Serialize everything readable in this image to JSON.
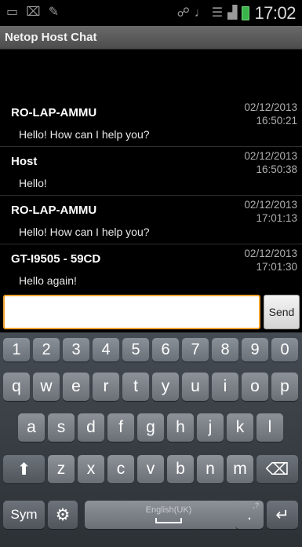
{
  "status_bar": {
    "time": "17:02",
    "icons_left": [
      "keyboard-icon",
      "usb-debug-icon",
      "wrench-icon"
    ],
    "icons_right": [
      "nfc-icon",
      "silent-mode-icon",
      "wifi-icon",
      "signal-icon",
      "battery-icon"
    ]
  },
  "app": {
    "title": "Netop Host Chat"
  },
  "messages": [
    {
      "sender": "RO-LAP-AMMU",
      "date": "02/12/2013",
      "time": "16:50:21",
      "text": "Hello! How can I help you?"
    },
    {
      "sender": "Host",
      "date": "02/12/2013",
      "time": "16:50:38",
      "text": "Hello!"
    },
    {
      "sender": "RO-LAP-AMMU",
      "date": "02/12/2013",
      "time": "17:01:13",
      "text": "Hello! How can I help you?"
    },
    {
      "sender": "GT-I9505 - 59CD",
      "date": "02/12/2013",
      "time": "17:01:30",
      "text": "Hello again!"
    }
  ],
  "input": {
    "value": "",
    "placeholder": "",
    "send_label": "Send"
  },
  "keyboard": {
    "numbers": [
      "1",
      "2",
      "3",
      "4",
      "5",
      "6",
      "7",
      "8",
      "9",
      "0"
    ],
    "row1": [
      "q",
      "w",
      "e",
      "r",
      "t",
      "y",
      "u",
      "i",
      "o",
      "p"
    ],
    "row2": [
      "a",
      "s",
      "d",
      "f",
      "g",
      "h",
      "j",
      "k",
      "l"
    ],
    "row3": [
      "z",
      "x",
      "c",
      "v",
      "b",
      "n",
      "m"
    ],
    "sym_label": "Sym",
    "space_label": "English(UK)",
    "punct_label": ".",
    "punct_sup": ",?",
    "shift_glyph": "⬆",
    "backspace_glyph": "⌫",
    "enter_glyph": "↵",
    "settings_glyph": "⚙"
  },
  "colors": {
    "accent": "#f0a030",
    "battery": "#3ab54a"
  }
}
